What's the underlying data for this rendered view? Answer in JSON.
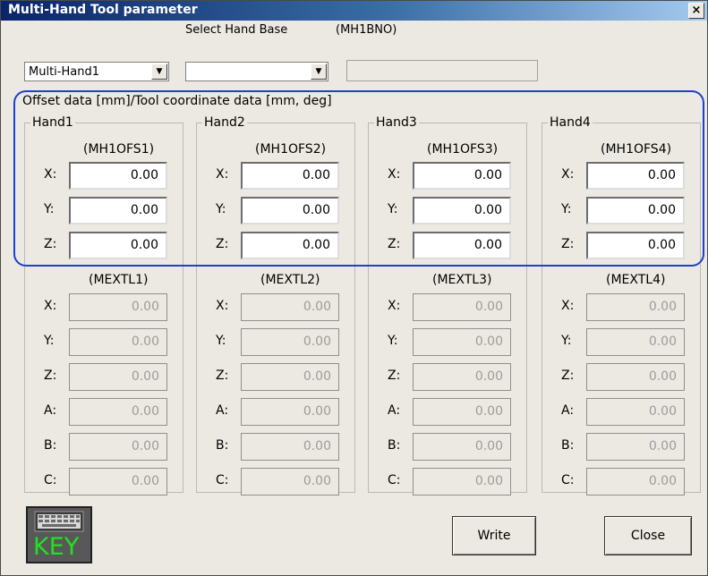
{
  "window": {
    "title": "Multi-Hand Tool parameter",
    "close_glyph": "×"
  },
  "top": {
    "hand_select": "Multi-Hand1",
    "select_base_label": "Select Hand Base",
    "base_param_label": "(MH1BNO)",
    "base_select": "",
    "base_readonly": ""
  },
  "section_title": "Offset data [mm]/Tool coordinate data [mm, deg]",
  "hands": [
    {
      "name": "Hand1",
      "ofs_param": "(MH1OFS1)",
      "ofs": [
        "0.00",
        "0.00",
        "0.00"
      ],
      "tool_param": "(MEXTL1)",
      "tool": [
        "0.00",
        "0.00",
        "0.00",
        "0.00",
        "0.00",
        "0.00"
      ]
    },
    {
      "name": "Hand2",
      "ofs_param": "(MH1OFS2)",
      "ofs": [
        "0.00",
        "0.00",
        "0.00"
      ],
      "tool_param": "(MEXTL2)",
      "tool": [
        "0.00",
        "0.00",
        "0.00",
        "0.00",
        "0.00",
        "0.00"
      ]
    },
    {
      "name": "Hand3",
      "ofs_param": "(MH1OFS3)",
      "ofs": [
        "0.00",
        "0.00",
        "0.00"
      ],
      "tool_param": "(MEXTL3)",
      "tool": [
        "0.00",
        "0.00",
        "0.00",
        "0.00",
        "0.00",
        "0.00"
      ]
    },
    {
      "name": "Hand4",
      "ofs_param": "(MH1OFS4)",
      "ofs": [
        "0.00",
        "0.00",
        "0.00"
      ],
      "tool_param": "(MEXTL4)",
      "tool": [
        "0.00",
        "0.00",
        "0.00",
        "0.00",
        "0.00",
        "0.00"
      ]
    }
  ],
  "axes": {
    "ofs": [
      "X:",
      "Y:",
      "Z:"
    ],
    "tool": [
      "X:",
      "Y:",
      "Z:",
      "A:",
      "B:",
      "C:"
    ]
  },
  "buttons": {
    "key": "KEY",
    "write": "Write",
    "close": "Close"
  }
}
